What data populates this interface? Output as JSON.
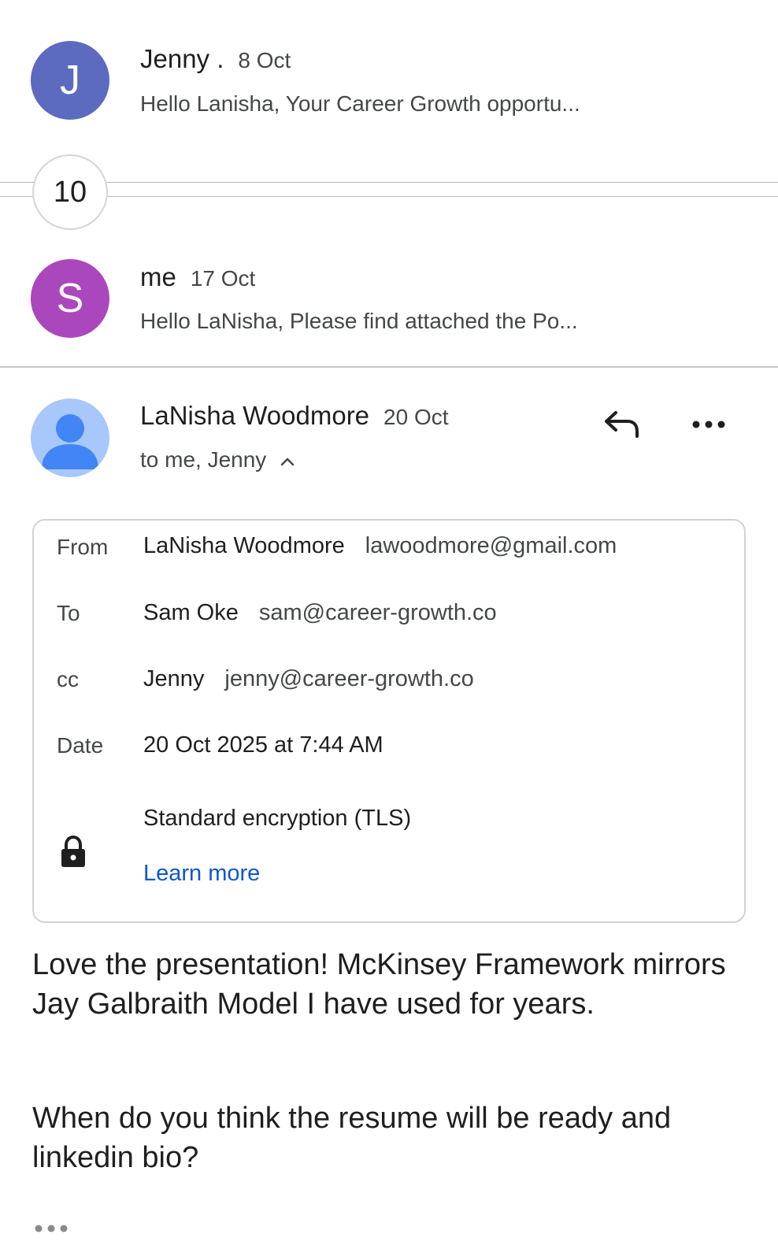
{
  "thread": [
    {
      "avatar_letter": "J",
      "avatar_color": "#5c6bc0",
      "sender": "Jenny .",
      "date": "8 Oct",
      "snippet": "Hello Lanisha, Your Career Growth opportu..."
    },
    {
      "avatar_letter": "S",
      "avatar_color": "#ab47bc",
      "sender": "me",
      "date": "17 Oct",
      "snippet": "Hello LaNisha, Please find attached the Po..."
    }
  ],
  "collapsed_count": "10",
  "open_message": {
    "sender": "LaNisha Woodmore",
    "date": "20 Oct",
    "recipients_summary": "to me, Jenny",
    "avatar_icon": "person-icon",
    "avatar_color": "#a8c7fa",
    "details": {
      "from_label": "From",
      "from_name": "LaNisha Woodmore",
      "from_email": "lawoodmore@gmail.com",
      "to_label": "To",
      "to_name": "Sam Oke",
      "to_email": "sam@career-growth.co",
      "cc_label": "cc",
      "cc_name": "Jenny",
      "cc_email": "jenny@career-growth.co",
      "date_label": "Date",
      "date_value": "20 Oct 2025 at 7:44 AM",
      "encryption": "Standard encryption (TLS)",
      "learn_more": "Learn more"
    },
    "body_p1": "Love the presentation! McKinsey Framework mirrors Jay Galbraith Model I have used for years.",
    "body_p2": "When do you think the resume will be ready and linkedin bio?"
  },
  "colors": {
    "link": "#0b57d0",
    "text_primary": "#1f1f1f",
    "text_secondary": "#444746",
    "avatar_person": "#4285f4"
  }
}
